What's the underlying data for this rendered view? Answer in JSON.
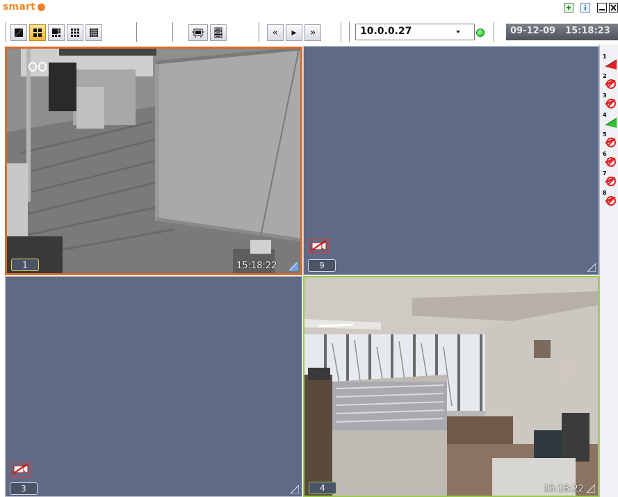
{
  "app": {
    "logo_text": "smart"
  },
  "toolbar": {
    "layout_buttons": [
      {
        "name": "layout-1x1-button",
        "icon": "layout-single-icon",
        "active": false
      },
      {
        "name": "layout-2x2-button",
        "icon": "layout-quad-icon",
        "active": true
      },
      {
        "name": "layout-1plus5-button",
        "icon": "layout-1plus5-icon",
        "active": false
      },
      {
        "name": "layout-3x3-button",
        "icon": "layout-nine-icon",
        "active": false
      },
      {
        "name": "layout-4x4-button",
        "icon": "layout-sixteen-icon",
        "active": false
      }
    ],
    "view_buttons": [
      {
        "name": "camera-strip-button",
        "icon": "camera-strip-icon"
      },
      {
        "name": "camera-tree-button",
        "icon": "camera-tree-icon"
      }
    ],
    "playback_buttons": [
      {
        "name": "rewind-button",
        "glyph": "«"
      },
      {
        "name": "play-button",
        "glyph": "▸"
      },
      {
        "name": "fast-forward-button",
        "glyph": "»"
      }
    ]
  },
  "server": {
    "address": "10.0.0.27",
    "status": "connected",
    "status_color": "#22c233"
  },
  "clock": {
    "date": "09-12-09",
    "time": "15:18:23"
  },
  "cameras": [
    {
      "number": "1",
      "timestamp": "15:18:22",
      "state": "selected",
      "signal": true
    },
    {
      "number": "9",
      "timestamp": "",
      "state": "no-signal",
      "signal": false
    },
    {
      "number": "3",
      "timestamp": "",
      "state": "no-signal",
      "signal": false
    },
    {
      "number": "4",
      "timestamp": "15:18:22",
      "state": "live",
      "signal": true
    }
  ],
  "channels": [
    {
      "number": "1",
      "status": "alarm",
      "color": "#e02424"
    },
    {
      "number": "2",
      "status": "disabled",
      "color": "#e02424"
    },
    {
      "number": "3",
      "status": "disabled",
      "color": "#e02424"
    },
    {
      "number": "4",
      "status": "active",
      "color": "#2fbf2f"
    },
    {
      "number": "5",
      "status": "disabled",
      "color": "#e02424"
    },
    {
      "number": "6",
      "status": "disabled",
      "color": "#e02424"
    },
    {
      "number": "7",
      "status": "disabled",
      "color": "#e02424"
    },
    {
      "number": "8",
      "status": "disabled",
      "color": "#e02424"
    }
  ],
  "colors": {
    "selected_border": "#dc6a2a",
    "live_border": "#9acb4a",
    "empty_feed": "#5e6a86",
    "brand": "#ef8a2a"
  }
}
